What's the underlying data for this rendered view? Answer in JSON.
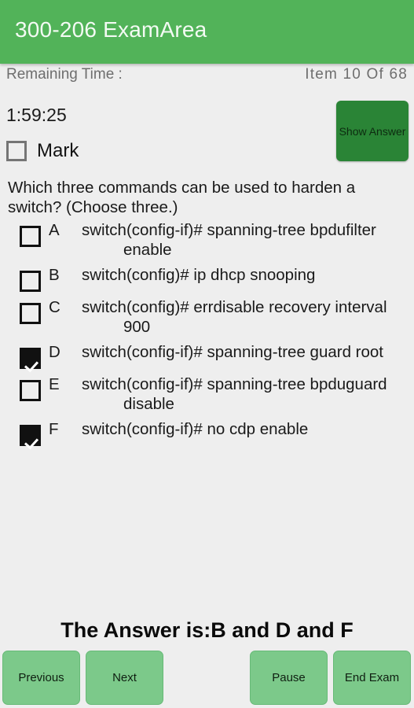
{
  "app": {
    "title": "300-206 ExamArea",
    "header_color": "#52b359",
    "background_color": "#eeeeee"
  },
  "status": {
    "remaining_time_label": "Remaining Time :",
    "item_counter": "Item 10 Of 68",
    "timer_value": "1:59:25"
  },
  "actions": {
    "show_answer_label": "Show Answer",
    "show_answer_color": "#2a8436"
  },
  "mark": {
    "label": "Mark",
    "checked": false
  },
  "question": {
    "text": "Which three commands can be used to harden a switch? (Choose three.)"
  },
  "options": [
    {
      "letter": "A",
      "text": "switch(config-if)# spanning-tree bpdufilter enable",
      "checked": false
    },
    {
      "letter": "B",
      "text": "switch(config)# ip dhcp snooping",
      "checked": false
    },
    {
      "letter": "C",
      "text": "switch(config)# errdisable recovery interval 900",
      "checked": false
    },
    {
      "letter": "D",
      "text": "switch(config-if)# spanning-tree guard root",
      "checked": true
    },
    {
      "letter": "E",
      "text": "switch(config-if)# spanning-tree bpduguard disable",
      "checked": false
    },
    {
      "letter": "F",
      "text": "switch(config-if)# no cdp enable",
      "checked": true
    }
  ],
  "answer": {
    "text": "The Answer is:B and D and F"
  },
  "bottom_bar": {
    "previous_label": "Previous",
    "next_label": "Next",
    "pause_label": "Pause",
    "end_exam_label": "End Exam",
    "button_color": "#7cc98a"
  }
}
